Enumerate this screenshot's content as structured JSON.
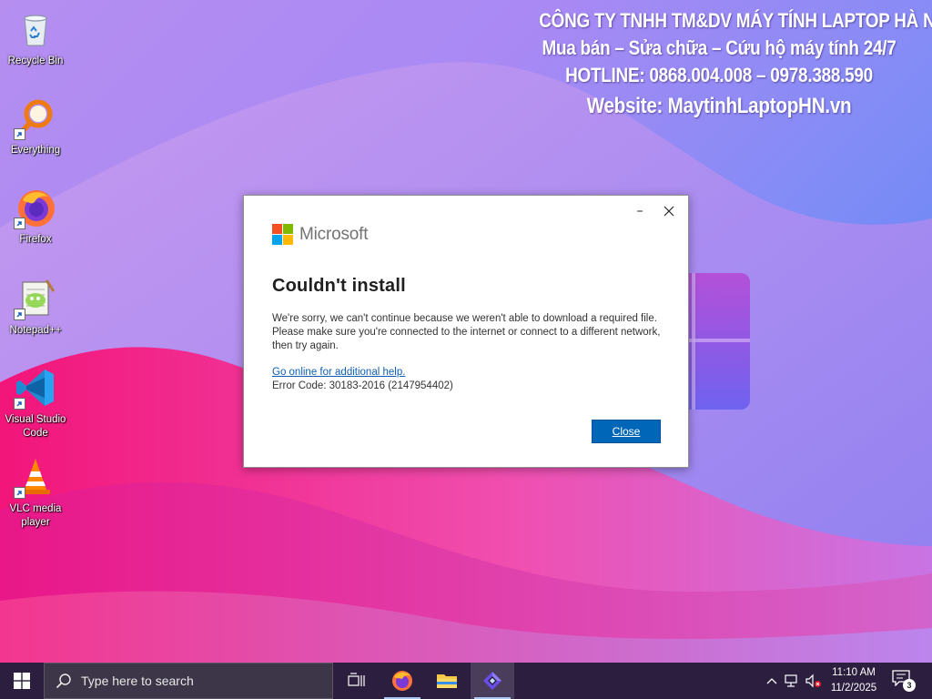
{
  "watermark": {
    "line1": "CÔNG TY TNHH TM&DV MÁY TÍNH LAPTOP HÀ NỘI",
    "line2": "Mua bán – Sửa chữa – Cứu hộ máy tính 24/7",
    "line3": "HOTLINE: 0868.004.008 – 0978.388.590",
    "line4": "Website: MaytinhLaptopHN.vn"
  },
  "desktop_icons": [
    {
      "label": "Recycle Bin",
      "icon": "recycle-bin-icon"
    },
    {
      "label": "Everything",
      "icon": "everything-search-icon"
    },
    {
      "label": "Firefox",
      "icon": "firefox-icon"
    },
    {
      "label": "Notepad++",
      "icon": "notepad-plus-plus-icon"
    },
    {
      "label": "Visual Studio Code",
      "icon": "vscode-icon"
    },
    {
      "label": "VLC media player",
      "icon": "vlc-cone-icon"
    }
  ],
  "dialog": {
    "brand": "Microsoft",
    "title": "Couldn't install",
    "message": "We're sorry, we can't continue because we weren't able to download a required file.  Please make sure you're connected to the internet or connect to a different network, then try again.",
    "help_link": "Go online for additional help.",
    "error_code": "Error Code: 30183-2016 (2147954402)",
    "close_label": "Close",
    "minimize_glyph": "–",
    "colors": {
      "logo_red": "#f25022",
      "logo_green": "#7fba00",
      "logo_blue": "#00a4ef",
      "logo_yellow": "#ffb900",
      "button_blue": "#0067b8"
    }
  },
  "taskbar": {
    "search_placeholder": "Type here to search",
    "apps": [
      "task-view-icon",
      "firefox-icon",
      "file-explorer-icon",
      "clipchamp-icon"
    ],
    "clock_time": "11:10 AM",
    "clock_date": "11/2/2025",
    "notification_count": "3"
  }
}
